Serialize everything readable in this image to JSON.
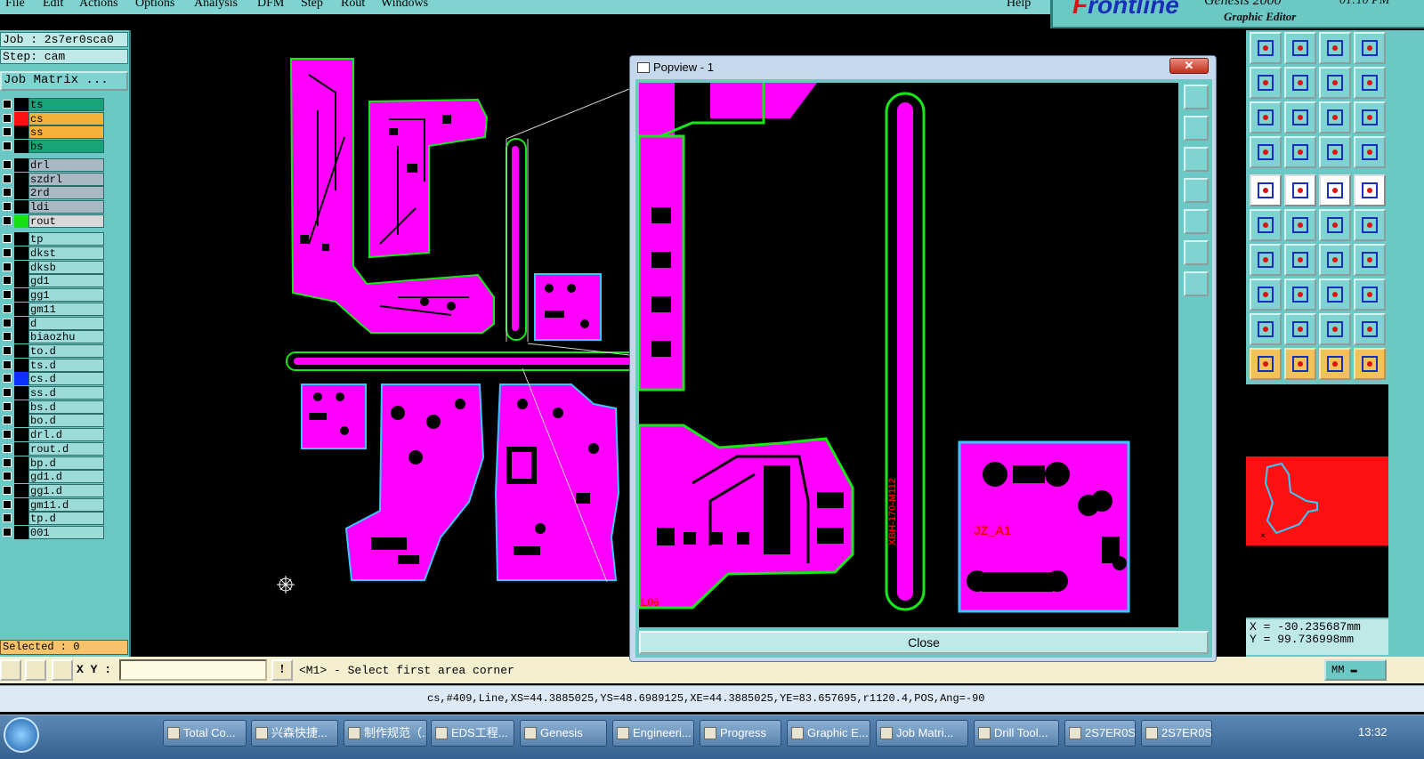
{
  "menu": [
    "File",
    "Edit",
    "Actions",
    "Options",
    "Analysis",
    "DFM",
    "Step",
    "Rout",
    "Windows",
    "Help"
  ],
  "brand": {
    "logo_a": "F",
    "logo_b": "rontline",
    "product": "Genesis 2000",
    "subtitle": "Graphic Editor",
    "time": "01:10 PM"
  },
  "job": {
    "job_label": "Job : 2s7er0sca0",
    "step_label": "Step: cam",
    "matrix_button": "Job Matrix ..."
  },
  "layers": [
    {
      "name": "ts",
      "color": "#1aa378",
      "swatch": "#000"
    },
    {
      "name": "cs",
      "color": "#f5b23a",
      "swatch": "#ff1010",
      "active": true
    },
    {
      "name": "ss",
      "color": "#f5b23a",
      "swatch": "#000"
    },
    {
      "name": "bs",
      "color": "#1aa378",
      "swatch": "#000"
    },
    {
      "name": "drl",
      "color": "#a9b9c4",
      "swatch": "#000",
      "gap": true
    },
    {
      "name": "szdrl",
      "color": "#a9b9c4",
      "swatch": "#000"
    },
    {
      "name": "2rd",
      "color": "#a9b9c4",
      "swatch": "#000"
    },
    {
      "name": "ldi",
      "color": "#a9b9c4",
      "swatch": "#000"
    },
    {
      "name": "rout",
      "color": "#d9d9d9",
      "swatch": "#16e016"
    },
    {
      "name": "tp",
      "color": "#9ddbd8",
      "swatch": "#000",
      "gap": true
    },
    {
      "name": "dkst",
      "color": "#9ddbd8",
      "swatch": "#000"
    },
    {
      "name": "dksb",
      "color": "#9ddbd8",
      "swatch": "#000"
    },
    {
      "name": "gd1",
      "color": "#9ddbd8",
      "swatch": "#000"
    },
    {
      "name": "gg1",
      "color": "#9ddbd8",
      "swatch": "#000"
    },
    {
      "name": "gm11",
      "color": "#9ddbd8",
      "swatch": "#000"
    },
    {
      "name": "d",
      "color": "#9ddbd8",
      "swatch": "#000"
    },
    {
      "name": "biaozhu",
      "color": "#9ddbd8",
      "swatch": "#000"
    },
    {
      "name": "to.d",
      "color": "#9ddbd8",
      "swatch": "#000"
    },
    {
      "name": "ts.d",
      "color": "#9ddbd8",
      "swatch": "#000"
    },
    {
      "name": "cs.d",
      "color": "#9ddbd8",
      "swatch": "#1030ff"
    },
    {
      "name": "ss.d",
      "color": "#9ddbd8",
      "swatch": "#000"
    },
    {
      "name": "bs.d",
      "color": "#9ddbd8",
      "swatch": "#000"
    },
    {
      "name": "bo.d",
      "color": "#9ddbd8",
      "swatch": "#000"
    },
    {
      "name": "drl.d",
      "color": "#9ddbd8",
      "swatch": "#000"
    },
    {
      "name": "rout.d",
      "color": "#9ddbd8",
      "swatch": "#000"
    },
    {
      "name": "bp.d",
      "color": "#9ddbd8",
      "swatch": "#000"
    },
    {
      "name": "gd1.d",
      "color": "#9ddbd8",
      "swatch": "#000"
    },
    {
      "name": "gg1.d",
      "color": "#9ddbd8",
      "swatch": "#000"
    },
    {
      "name": "gm11.d",
      "color": "#9ddbd8",
      "swatch": "#000"
    },
    {
      "name": "tp.d",
      "color": "#9ddbd8",
      "swatch": "#000"
    },
    {
      "name": "001",
      "color": "#9ddbd8",
      "swatch": "#000"
    }
  ],
  "selected": "Selected : 0",
  "popup": {
    "title": "Popview - 1",
    "close_x": "✕",
    "close_button": "Close",
    "board_label": "JZ_A1",
    "vertical_label": "XBH-170-M112",
    "corner_label": "L06"
  },
  "coords": {
    "x": "X = -30.235687mm",
    "y": "Y =  99.736998mm"
  },
  "command": {
    "xy_label": "X Y :",
    "xy_value": "",
    "excl": "!",
    "prompt": "<M1> - Select first area corner",
    "units": "MM"
  },
  "status": "cs,#409,Line,XS=44.3885025,YS=48.6989125,XE=44.3885025,YE=83.657695,r1120.4,POS,Ang=-90",
  "taskbar": [
    "Total Co...",
    "兴森快捷...",
    "制作规范（...",
    "EDS工程...",
    "Genesis",
    "Engineeri...",
    "Progress",
    "Graphic E...",
    "Job Matri...",
    "Drill Tool...",
    "2S7ER0S...",
    "2S7ER0S..."
  ],
  "clock": "13:32",
  "colors": {
    "pcb": "#ff00ff",
    "outline": "#19e619",
    "edge": "#38c8ff",
    "panel": "#6cc8c4"
  }
}
